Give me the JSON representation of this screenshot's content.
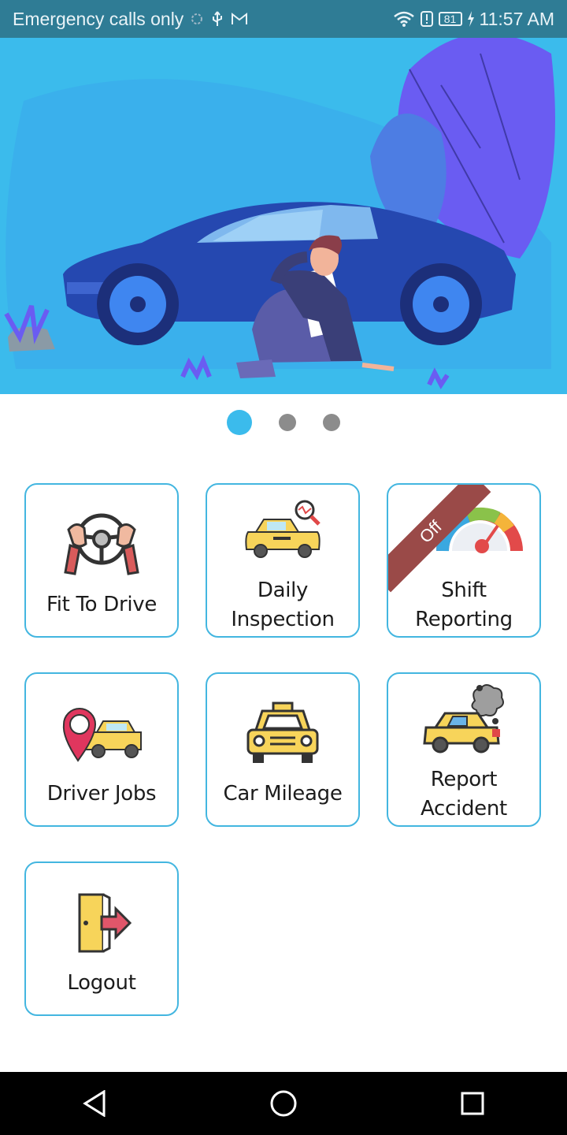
{
  "status_bar": {
    "carrier": "Emergency calls only",
    "battery": "81",
    "time": "11:57 AM"
  },
  "carousel": {
    "page_count": 3,
    "active_page": 1
  },
  "menu": {
    "fit_to_drive": "Fit To Drive",
    "daily_inspection": [
      "Daily",
      "Inspection"
    ],
    "shift_reporting": [
      "Shift",
      "Reporting"
    ],
    "shift_badge": "Off",
    "driver_jobs": "Driver Jobs",
    "car_mileage": "Car Mileage",
    "report_accident": [
      "Report",
      "Accident"
    ],
    "logout": "Logout"
  },
  "colors": {
    "status_bar": "#2f7c95",
    "banner": "#3bbbec",
    "tile_border": "#43b6e0",
    "dot_active": "#3bbbec",
    "dot_inactive": "#8c8c8c",
    "ribbon": "#9a4a48"
  },
  "icons": {
    "nav_back": "triangle-back-icon",
    "nav_home": "circle-home-icon",
    "nav_recents": "square-recents-icon"
  }
}
